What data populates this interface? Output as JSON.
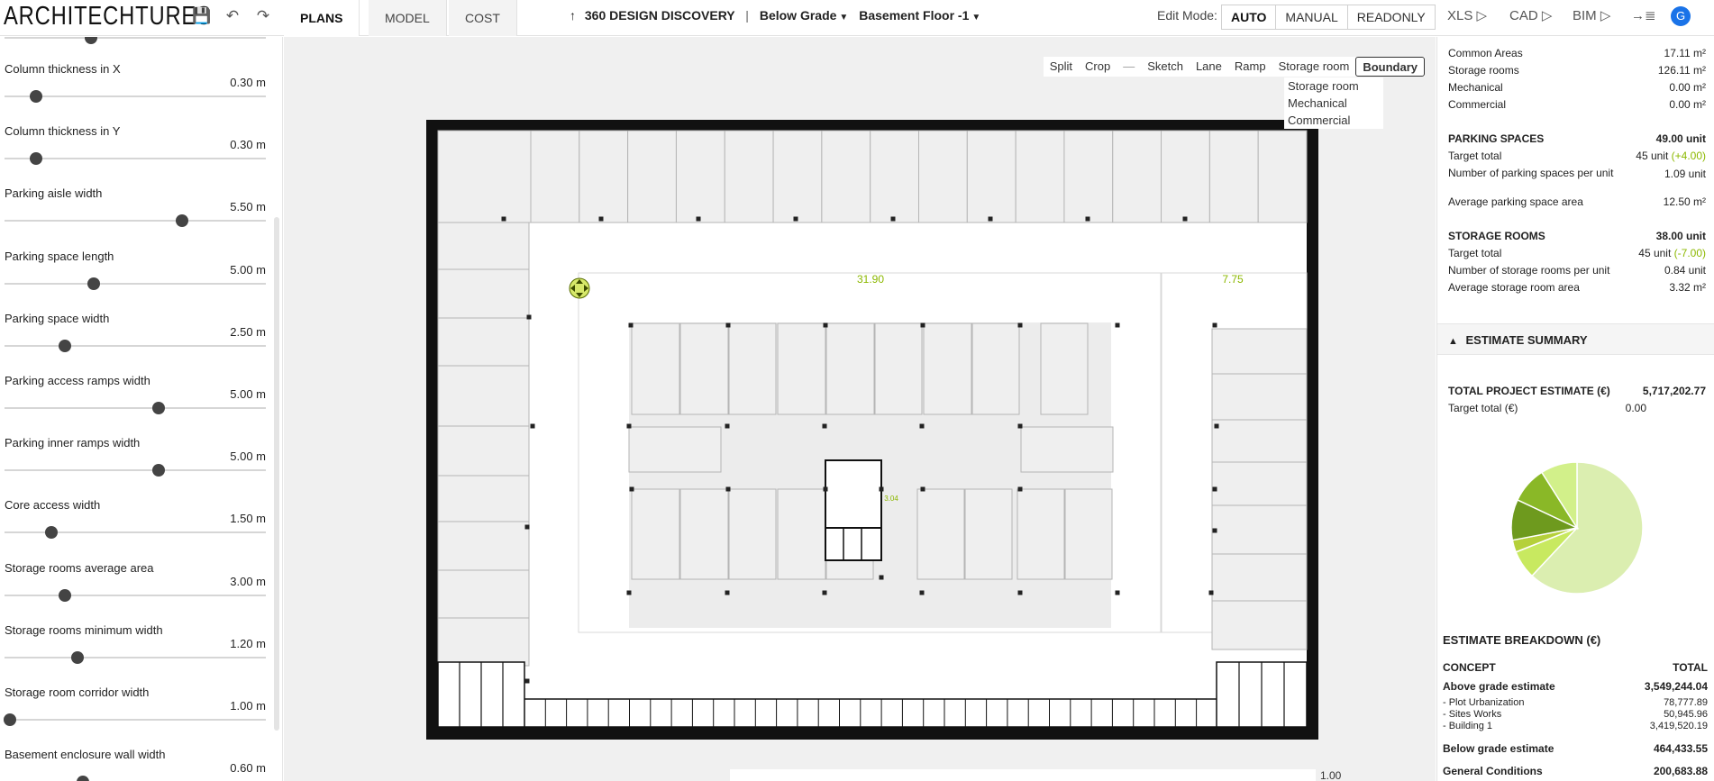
{
  "app": {
    "logo": "ARCHITECHTURES",
    "icons": {
      "save": "💾",
      "undo": "↶",
      "redo": "↷"
    },
    "tabs": [
      {
        "label": "PLANS",
        "active": true
      },
      {
        "label": "MODEL",
        "active": false
      },
      {
        "label": "COST",
        "active": false
      }
    ],
    "project": {
      "arrow": "↑",
      "name": "360 DESIGN DISCOVERY",
      "separator": "|",
      "level": "Below Grade",
      "floor": "Basement Floor -1"
    },
    "edit_mode_label": "Edit Mode:",
    "modes": [
      {
        "label": "AUTO",
        "active": true
      },
      {
        "label": "MANUAL",
        "active": false
      },
      {
        "label": "READONLY",
        "active": false
      }
    ],
    "exports": [
      {
        "label": "XLS ▷"
      },
      {
        "label": "CAD ▷"
      },
      {
        "label": "BIM ▷"
      },
      {
        "label": "→≣"
      }
    ],
    "avatar": "G",
    "accent_color": "#8cb800"
  },
  "sidebar": {
    "params": [
      {
        "label": "Column thickness in X",
        "value": "0.30 m",
        "level": 0.12
      },
      {
        "label": "Column thickness in Y",
        "value": "0.30 m",
        "level": 0.12
      },
      {
        "label": "Parking aisle width",
        "value": "5.50 m",
        "level": 0.68
      },
      {
        "label": "Parking space length",
        "value": "5.00 m",
        "level": 0.34
      },
      {
        "label": "Parking space width",
        "value": "2.50 m",
        "level": 0.23
      },
      {
        "label": "Parking access ramps width",
        "value": "5.00 m",
        "level": 0.59
      },
      {
        "label": "Parking inner ramps width",
        "value": "5.00 m",
        "level": 0.59
      },
      {
        "label": "Core access width",
        "value": "1.50 m",
        "level": 0.18
      },
      {
        "label": "Storage rooms average area",
        "value": "3.00 m",
        "level": 0.23
      },
      {
        "label": "Storage rooms minimum width",
        "value": "1.20 m",
        "level": 0.28
      },
      {
        "label": "Storage room corridor width",
        "value": "1.00 m",
        "level": 0.02
      },
      {
        "label": "Basement enclosure wall width",
        "value": "0.60 m",
        "level": 0.3
      }
    ]
  },
  "canvas": {
    "tools": [
      {
        "label": "Split",
        "active": false
      },
      {
        "label": "Crop",
        "active": false
      },
      {
        "label": "—",
        "active": false
      },
      {
        "label": "Sketch",
        "active": false
      },
      {
        "label": "Lane",
        "active": false
      },
      {
        "label": "Ramp",
        "active": false
      },
      {
        "label": "Storage room",
        "active": false
      },
      {
        "label": "Boundary",
        "active": true
      }
    ],
    "dropdown_options": [
      "Storage room",
      "Mechanical",
      "Commercial"
    ],
    "dim_labels": {
      "left_span": "31.90",
      "right_span": "7.75",
      "core": "3.04"
    },
    "scale_value": "1.00"
  },
  "summary": {
    "area_rows": [
      {
        "label": "Common Areas",
        "value": "17.11 m²"
      },
      {
        "label": "Storage rooms",
        "value": "126.11 m²"
      },
      {
        "label": "Mechanical",
        "value": "0.00 m²"
      },
      {
        "label": "Commercial",
        "value": "0.00 m²"
      }
    ],
    "parking": {
      "title": "PARKING SPACES",
      "value": "49.00 unit",
      "target_label": "Target total",
      "target_value": "45 unit",
      "target_delta": "(+4.00)",
      "per_unit_label": "Number of parking spaces per unit",
      "per_unit_value": "1.09 unit",
      "avg_label": "Average parking space area",
      "avg_value": "12.50 m²"
    },
    "storage": {
      "title": "STORAGE ROOMS",
      "value": "38.00 unit",
      "target_label": "Target total",
      "target_value": "45 unit",
      "target_delta": "(-7.00)",
      "per_unit_label": "Number of storage rooms per unit",
      "per_unit_value": "0.84 unit",
      "avg_label": "Average storage room area",
      "avg_value": "3.32 m²"
    }
  },
  "estimate": {
    "header": "ESTIMATE SUMMARY",
    "total_label": "TOTAL PROJECT ESTIMATE (€)",
    "total_value": "5,717,202.77",
    "target_label": "Target total (€)",
    "target_value": "0.00",
    "breakdown_title": "ESTIMATE BREAKDOWN (€)",
    "col_concept": "CONCEPT",
    "col_total": "TOTAL",
    "above": {
      "label": "Above grade estimate",
      "value": "3,549,244.04"
    },
    "above_items": [
      {
        "label": "- Plot Urbanization",
        "value": "78,777.89"
      },
      {
        "label": "- Sites Works",
        "value": "50,945.96"
      },
      {
        "label": "- Building 1",
        "value": "3,419,520.19"
      }
    ],
    "below": {
      "label": "Below grade estimate",
      "value": "464,433.55"
    },
    "general": {
      "label": "General Conditions",
      "value": "200,683.88"
    },
    "pie": [
      {
        "value": 62,
        "color": "#dbeeb0"
      },
      {
        "value": 7,
        "color": "#c8e960"
      },
      {
        "value": 3,
        "color": "#b5d03a"
      },
      {
        "value": 10,
        "color": "#6e9a1e"
      },
      {
        "value": 9,
        "color": "#8ab827"
      },
      {
        "value": 9,
        "color": "#d2f08a"
      }
    ]
  }
}
